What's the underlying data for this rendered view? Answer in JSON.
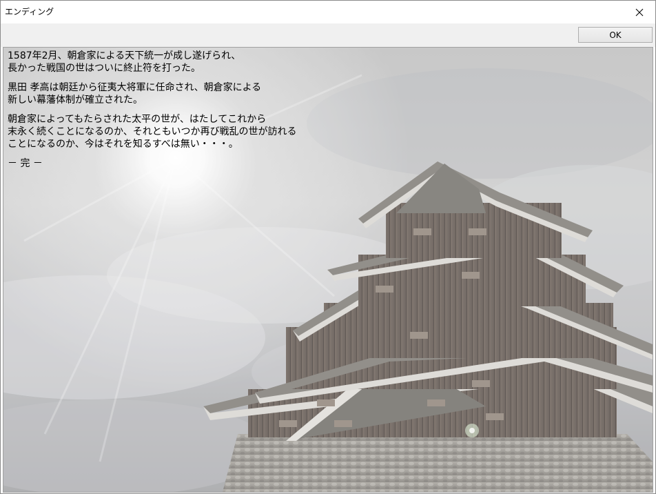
{
  "window": {
    "title": "エンディング"
  },
  "toolbar": {
    "ok_label": "OK"
  },
  "story": {
    "paragraphs": [
      [
        "1587年2月、朝倉家による天下統一が成し遂げられ、",
        "長かった戦国の世はついに終止符を打った。"
      ],
      [
        "黒田 孝高は朝廷から征夷大将軍に任命され、朝倉家による",
        "新しい幕藩体制が確立された。"
      ],
      [
        "朝倉家によってもたらされた太平の世が、はたしてこれから",
        "末永く続くことになるのか、それともいつか再び戦乱の世が訪れる",
        "ことになるのか、今はそれを知るすべは無い・・・。"
      ],
      [
        "－ 完 －"
      ]
    ]
  },
  "background": {
    "image": "castle-illustration",
    "colors": {
      "sky": "#c4c5c8",
      "sunlight": "#ffffff",
      "roof": "#6e6c66",
      "wall": "#5b4f47",
      "stone": "#8f8c86"
    }
  }
}
